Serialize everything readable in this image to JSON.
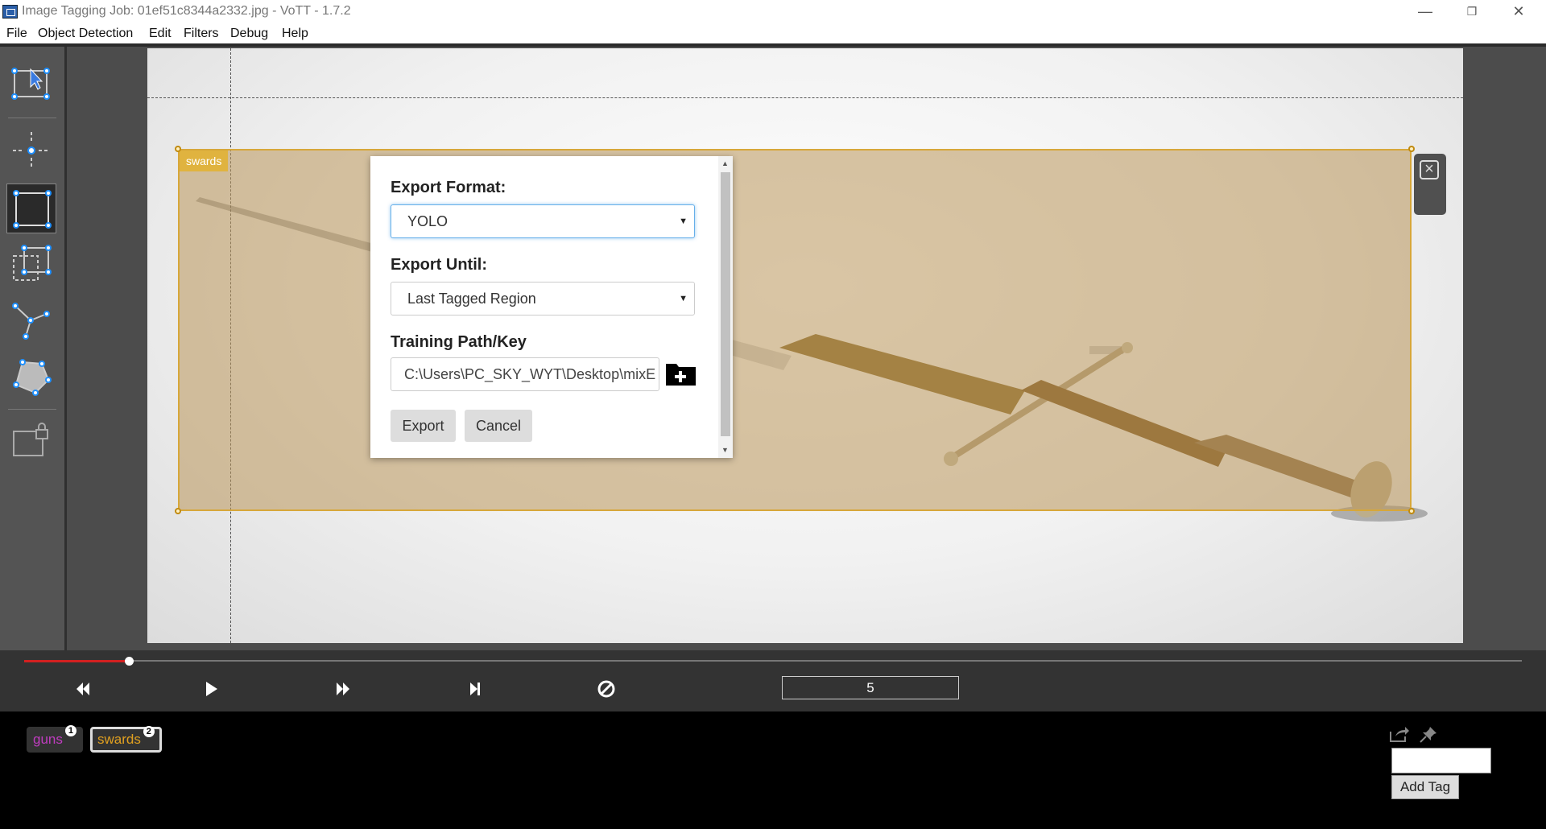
{
  "window": {
    "title": "Image Tagging Job: 01ef51c8344a2332.jpg - VoTT - 1.7.2",
    "controls": {
      "minimize": "—",
      "restore": "❐",
      "close": "✕"
    }
  },
  "menu": [
    "File",
    "Object Detection",
    "Edit",
    "Filters",
    "Debug",
    "Help"
  ],
  "toolbar": {
    "tools": [
      "select-tool",
      "point-tool",
      "rectangle-tool",
      "copy-rect-tool",
      "polyline-tool",
      "polygon-tool",
      "lock-tool"
    ],
    "active_tool": "rectangle-tool"
  },
  "canvas": {
    "region_tag": "swards",
    "region_color": "#e0b33f"
  },
  "export_dialog": {
    "format_label": "Export Format:",
    "format_value": "YOLO",
    "until_label": "Export Until:",
    "until_value": "Last Tagged Region",
    "path_label": "Training Path/Key",
    "path_value": "C:\\Users\\PC_SKY_WYT\\Desktop\\mixE",
    "export_button": "Export",
    "cancel_button": "Cancel"
  },
  "player": {
    "progress_fraction": 0.07,
    "frame_number": "5",
    "accent_color": "#d32020"
  },
  "tags": {
    "items": [
      {
        "name": "guns",
        "hotkey": "1",
        "color": "#c03cc0"
      },
      {
        "name": "swards",
        "hotkey": "2",
        "color": "#e0a020"
      }
    ],
    "selected": "swards",
    "add_tag_button": "Add Tag",
    "new_tag_value": ""
  }
}
